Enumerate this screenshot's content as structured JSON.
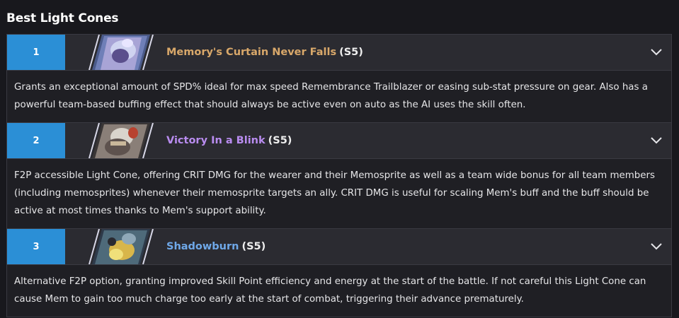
{
  "section": {
    "title": "Best Light Cones"
  },
  "items": [
    {
      "rank": "1",
      "name": "Memory's Curtain Never Falls",
      "superimposition": "(S5)",
      "name_color": "#d9a86a",
      "description": "Grants an exceptional amount of SPD% ideal for max speed Remembrance Trailblazer or easing sub-stat pressure on gear. Also has a powerful team-based buffing effect that should always be active even on auto as the AI uses the skill often."
    },
    {
      "rank": "2",
      "name": "Victory In a Blink",
      "superimposition": "(S5)",
      "name_color": "#b98cf0",
      "description": "F2P accessible Light Cone, offering CRIT DMG for the wearer and their Memosprite as well as a team wide bonus for all team members (including memosprites) whenever their memosprite targets an ally. CRIT DMG is useful for scaling Mem's buff and the buff should be active at most times thanks to Mem's support ability."
    },
    {
      "rank": "3",
      "name": "Shadowburn",
      "superimposition": "(S5)",
      "name_color": "#6fa8e8",
      "description": "Alternative F2P option, granting improved Skill Point efficiency and energy at the start of the battle. If not careful this Light Cone can cause Mem to gain too much charge too early at the start of combat, triggering their advance prematurely."
    }
  ],
  "icons": {
    "expand": "chevron-down-icon",
    "artwork": "light-cone-art"
  },
  "colors": {
    "rank_bg": "#2b8fd6",
    "row_bg": "#2b2b31",
    "desc_bg": "#1f1f24",
    "border": "#3a3a42"
  }
}
